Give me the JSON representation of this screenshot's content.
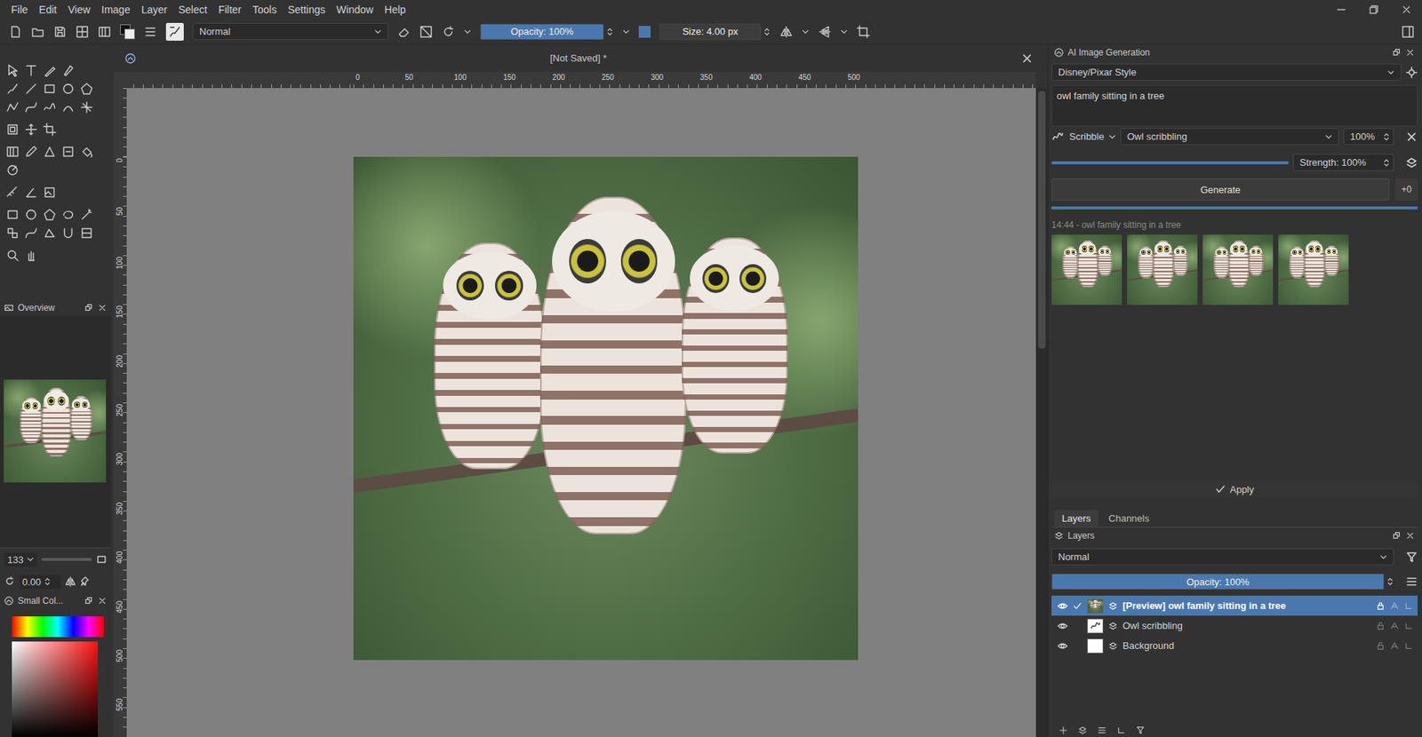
{
  "menu": [
    "File",
    "Edit",
    "View",
    "Image",
    "Layer",
    "Select",
    "Filter",
    "Tools",
    "Settings",
    "Window",
    "Help"
  ],
  "toolbar": {
    "blend_mode": "Normal",
    "opacity": {
      "label": "Opacity: 100%",
      "level": 1
    },
    "size": {
      "label": "Size: 4.00 px"
    }
  },
  "document": {
    "title": "[Not Saved] *"
  },
  "rulers": {
    "horizontal": [
      "0",
      "50",
      "100",
      "150",
      "200",
      "250",
      "300",
      "350",
      "400",
      "450",
      "500"
    ],
    "vertical": [
      "0",
      "50",
      "100",
      "150",
      "200",
      "250",
      "300",
      "350",
      "400",
      "450",
      "500",
      "550"
    ]
  },
  "overview": {
    "title": "Overview",
    "zoom": "133",
    "rotation": "0.00"
  },
  "color_docker": {
    "title": "Small Col..."
  },
  "ai_generation": {
    "title": "AI Image Generation",
    "style": "Disney/Pixar Style",
    "prompt": "owl family sitting in a tree",
    "control": {
      "mode": "Scribble",
      "layer": "Owl scribbling",
      "weight": "100%"
    },
    "strength": {
      "label": "Strength: 100%",
      "level": 1
    },
    "generate": "Generate",
    "queue": "+0",
    "progress": 1,
    "history": {
      "label": "14:44 - owl family sitting in a tree",
      "images": [
        {
          "selected": false
        },
        {
          "selected": false
        },
        {
          "selected": false
        },
        {
          "selected": false
        }
      ]
    },
    "apply": "Apply"
  },
  "layers_docker": {
    "tabs": [
      {
        "label": "Layers",
        "selected": true
      },
      {
        "label": "Channels",
        "selected": false
      }
    ],
    "title": "Layers",
    "blend_mode": "Normal",
    "opacity": {
      "label": "Opacity: 100%",
      "level": 1
    },
    "layers": [
      {
        "name": "[Preview] owl family sitting in a tree",
        "kind": "preview",
        "selected": true,
        "visible": true,
        "checked": true,
        "locked": true
      },
      {
        "name": "Owl scribbling",
        "kind": "sketch",
        "selected": false,
        "visible": true,
        "checked": false,
        "locked": false
      },
      {
        "name": "Background",
        "kind": "fill",
        "selected": false,
        "visible": true,
        "checked": false,
        "locked": false
      }
    ]
  }
}
